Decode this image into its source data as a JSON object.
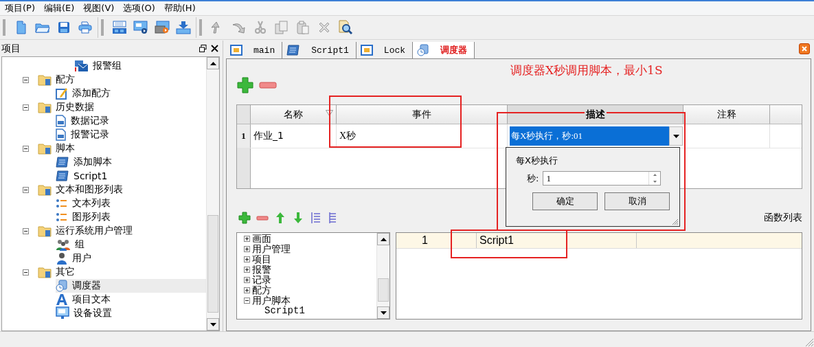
{
  "menu": [
    "项目(P)",
    "编辑(E)",
    "视图(V)",
    "选项(O)",
    "帮助(H)"
  ],
  "toolbar": [
    {
      "buttons": [
        {
          "kind": "new",
          "disabled": false
        },
        {
          "kind": "open",
          "disabled": false
        },
        {
          "kind": "save",
          "disabled": false
        },
        {
          "kind": "print",
          "disabled": false
        }
      ]
    },
    {
      "buttons": [
        {
          "kind": "grid",
          "disabled": false
        },
        {
          "kind": "screen",
          "disabled": false
        },
        {
          "kind": "record",
          "disabled": false
        },
        {
          "kind": "download",
          "disabled": false
        }
      ]
    },
    {
      "buttons": [
        {
          "kind": "undo",
          "disabled": true
        },
        {
          "kind": "redo",
          "disabled": true
        },
        {
          "kind": "cut",
          "disabled": true
        },
        {
          "kind": "copy",
          "disabled": true
        },
        {
          "kind": "paste",
          "disabled": true
        },
        {
          "kind": "delete",
          "disabled": true
        },
        {
          "kind": "find",
          "disabled": false
        }
      ]
    }
  ],
  "project_panel": {
    "title": "项目",
    "tree": [
      {
        "children": [
          {
            "children": [
              {
                "label": "报警组",
                "kind": "alarm",
                "selected": false
              }
            ]
          }
        ]
      },
      {
        "label": "配方",
        "kind": "folder",
        "expanded": true,
        "selected": false,
        "children": [
          {
            "label": "添加配方",
            "kind": "edit",
            "selected": false
          }
        ]
      },
      {
        "label": "历史数据",
        "kind": "folder",
        "expanded": true,
        "selected": false,
        "children": [
          {
            "label": "数据记录",
            "kind": "doc",
            "selected": false
          },
          {
            "label": "报警记录",
            "kind": "doc",
            "selected": false
          }
        ]
      },
      {
        "label": "脚本",
        "kind": "folder",
        "expanded": true,
        "selected": false,
        "children": [
          {
            "label": "添加脚本",
            "kind": "script",
            "selected": false
          },
          {
            "label": "Script1",
            "kind": "script",
            "selected": false
          }
        ]
      },
      {
        "label": "文本和图形列表",
        "kind": "folder",
        "expanded": true,
        "selected": false,
        "children": [
          {
            "label": "文本列表",
            "kind": "list",
            "selected": false
          },
          {
            "label": "图形列表",
            "kind": "list",
            "selected": false
          }
        ]
      },
      {
        "label": "运行系统用户管理",
        "kind": "folder",
        "expanded": true,
        "selected": false,
        "children": [
          {
            "label": "组",
            "kind": "group",
            "selected": false
          },
          {
            "label": "用户",
            "kind": "user",
            "selected": false
          }
        ]
      },
      {
        "label": "其它",
        "kind": "folder",
        "expanded": true,
        "selected": false,
        "children": [
          {
            "label": "调度器",
            "kind": "scheduler",
            "selected": true
          },
          {
            "label": "项目文本",
            "kind": "text",
            "selected": false
          },
          {
            "label": "设备设置",
            "kind": "device",
            "selected": false
          }
        ]
      }
    ]
  },
  "tabs": [
    {
      "label": "main",
      "kind": "screen",
      "selected": false
    },
    {
      "label": "Script1",
      "kind": "script",
      "selected": false
    },
    {
      "label": "Lock",
      "kind": "screen",
      "selected": false
    },
    {
      "label": "调度器",
      "kind": "scheduler",
      "selected": true
    }
  ],
  "annotation": "调度器X秒调用脚本，最小1S",
  "jobs_table": {
    "columns": [
      {
        "label": "名称",
        "sorted": true,
        "active": false
      },
      {
        "label": "事件",
        "sorted": false,
        "active": false
      },
      {
        "label": "描述",
        "sorted": false,
        "active": true
      },
      {
        "label": "注释",
        "sorted": false,
        "active": false
      }
    ],
    "rows": [
      {
        "number": "1",
        "name": "作业_1",
        "event": "X秒",
        "description": "每X秒执行，秒:01",
        "editing": true
      }
    ]
  },
  "editor_popup": {
    "title": "每X秒执行",
    "field_label": "秒:",
    "value": "1",
    "buttons": [
      "确定",
      "取消"
    ]
  },
  "function_toolbar": {
    "buttons": [
      {
        "kind": "add"
      },
      {
        "kind": "remove"
      },
      {
        "kind": "up"
      },
      {
        "kind": "down"
      },
      {
        "kind": "indent"
      },
      {
        "kind": "outdent"
      }
    ],
    "label": "函数列表"
  },
  "function_tree": [
    {
      "label": "画面",
      "expanded": false,
      "selected": false
    },
    {
      "label": "用户管理",
      "expanded": false,
      "selected": false
    },
    {
      "label": "项目",
      "expanded": false,
      "selected": false
    },
    {
      "label": "报警",
      "expanded": false,
      "selected": false
    },
    {
      "label": "记录",
      "expanded": false,
      "selected": false
    },
    {
      "label": "配方",
      "expanded": false,
      "selected": false
    },
    {
      "label": "用户脚本",
      "expanded": true,
      "selected": false,
      "children": [
        {
          "label": "Script1",
          "selected": false
        }
      ]
    }
  ],
  "function_list": {
    "rows": [
      {
        "number": "1",
        "name": "Script1"
      }
    ]
  }
}
